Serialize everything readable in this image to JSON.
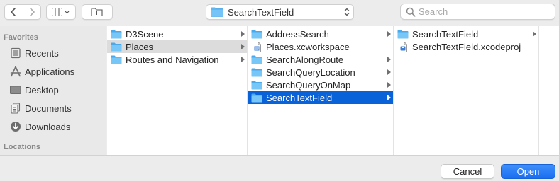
{
  "toolbar": {
    "back_icon": "chevron-left-icon",
    "forward_icon": "chevron-right-icon",
    "view_icon": "column-view-icon",
    "new_folder_icon": "new-folder-icon",
    "path_title": "SearchTextField",
    "search_placeholder": "Search"
  },
  "sidebar": {
    "favorites_heading": "Favorites",
    "items": [
      {
        "label": "Recents",
        "icon": "recents-icon"
      },
      {
        "label": "Applications",
        "icon": "applications-icon"
      },
      {
        "label": "Desktop",
        "icon": "desktop-icon"
      },
      {
        "label": "Documents",
        "icon": "documents-icon"
      },
      {
        "label": "Downloads",
        "icon": "downloads-icon"
      }
    ],
    "locations_heading": "Locations"
  },
  "columns": {
    "col1": [
      {
        "label": "D3Scene"
      },
      {
        "label": "Places"
      },
      {
        "label": "Routes and Navigation"
      }
    ],
    "col2": [
      {
        "label": "AddressSearch"
      },
      {
        "label": "Places.xcworkspace"
      },
      {
        "label": "SearchAlongRoute"
      },
      {
        "label": "SearchQueryLocation"
      },
      {
        "label": "SearchQueryOnMap"
      },
      {
        "label": "SearchTextField"
      }
    ],
    "col3": [
      {
        "label": "SearchTextField"
      },
      {
        "label": "SearchTextField.xcodeproj"
      }
    ]
  },
  "buttons": {
    "cancel": "Cancel",
    "open": "Open"
  },
  "colors": {
    "selection_blue": "#0a62d8",
    "folder_blue": "#5eb8f5",
    "open_button": "#1a6ff2"
  }
}
